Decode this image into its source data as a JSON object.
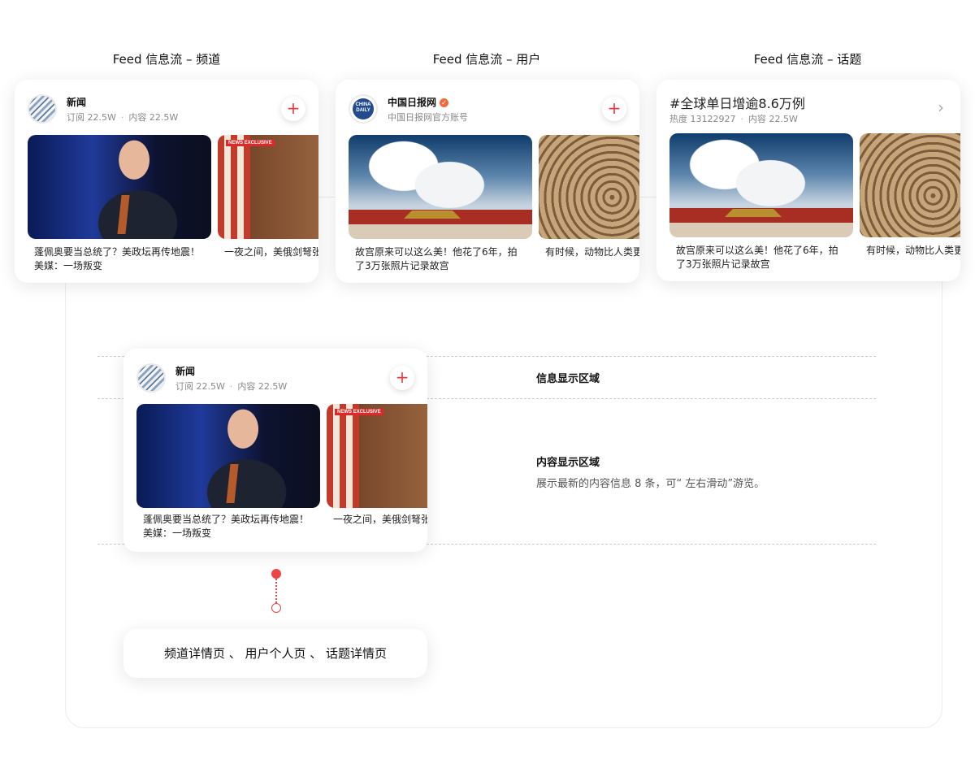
{
  "columns": {
    "channel_title": "Feed 信息流 – 频道",
    "user_title": "Feed 信息流 – 用户",
    "topic_title": "Feed 信息流 – 话题"
  },
  "channel_card": {
    "name": "新闻",
    "subs": "订阅 22.5W",
    "dot": "·",
    "content": "内容 22.5W",
    "follow": "+",
    "items": [
      {
        "caption": "蓬佩奥要当总统了？美政坛再传地震！美媒：一场叛变"
      },
      {
        "caption": "一夜之间，美俄剑弩张"
      }
    ]
  },
  "user_card": {
    "name": "中国日报网",
    "desc": "中国日报网官方账号",
    "avatar_text": "CHINA DAILY",
    "follow": "+",
    "verified": "✓",
    "items": [
      {
        "caption": "故宫原来可以这么美！他花了6年，拍了3万张照片记录故宫"
      },
      {
        "caption": "有时候，动物比人类更"
      }
    ]
  },
  "topic_card": {
    "title": "#全球单日增逾8.6万例",
    "heat": "热度 13122927",
    "dot": "·",
    "content": "内容 22.5W",
    "chevron": "›",
    "items": [
      {
        "caption": "故宫原来可以这么美！他花了6年，拍了3万张照片记录故宫"
      },
      {
        "caption": "有时候，动物比人类更"
      }
    ]
  },
  "annotations": {
    "info_area": "信息显示区域",
    "content_area": "内容显示区域",
    "content_desc": "展示最新的内容信息 8 条，可“ 左右滑动”游览。"
  },
  "abc_tag": "NEWS EXCLUSIVE",
  "destination": "频道详情页 、 用户个人页 、 话题详情页",
  "colors": {
    "accent_red": "#e93d3d",
    "text": "#111111",
    "muted": "#888888"
  }
}
